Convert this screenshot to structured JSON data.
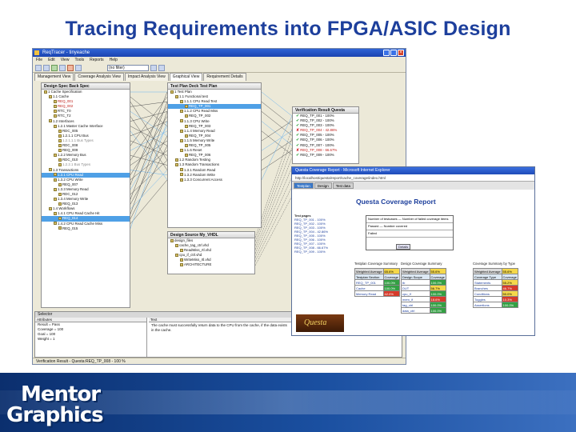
{
  "slide": {
    "title": "Tracing Requirements into FPGA/ASIC Design"
  },
  "app": {
    "window_title": "ReqTracer - tinyeache",
    "menu": [
      "File",
      "Edit",
      "View",
      "Tools",
      "Reports",
      "Help"
    ],
    "toolbar_select": "(no filter)",
    "tabs": [
      "Management View",
      "Coverage Analysis View",
      "Impact Analysis View",
      "Graphical View",
      "Requirement Details"
    ],
    "active_tab_index": 3,
    "panes": {
      "design_spec": {
        "header": "Design Spec   Back Spec",
        "rows": [
          {
            "text": "1 Cache Specification",
            "indent": 0
          },
          {
            "text": "1.1 Cache",
            "indent": 1
          },
          {
            "text": "REQ_001",
            "indent": 2,
            "style": "red"
          },
          {
            "text": "REQ_002",
            "indent": 2,
            "style": "red"
          },
          {
            "text": "RTC_T0",
            "indent": 2
          },
          {
            "text": "RTC_T2",
            "indent": 2
          },
          {
            "text": "1.2 Interfaces",
            "indent": 1
          },
          {
            "text": "1.2.1 Master Cache Interface",
            "indent": 2
          },
          {
            "text": "RDC_005",
            "indent": 3
          },
          {
            "text": "1.2.1.1 CPU Bus",
            "indent": 3
          },
          {
            "text": "1.2.1.1.1 Bus Types",
            "indent": 3,
            "style": "gray"
          },
          {
            "text": "RDC_008",
            "indent": 3
          },
          {
            "text": "REQ_009",
            "indent": 3
          },
          {
            "text": "1.2.2 Memory Bus",
            "indent": 2
          },
          {
            "text": "RDC_010",
            "indent": 3
          },
          {
            "text": "1.2.2.1 Bus Types",
            "indent": 3,
            "style": "gray"
          },
          {
            "text": "1.3 Transactions",
            "indent": 1
          },
          {
            "text": "1.3.1 CPU Read",
            "indent": 2,
            "style": "sel"
          },
          {
            "text": "1.3.2 CPU Write",
            "indent": 2
          },
          {
            "text": "REQ_007",
            "indent": 3
          },
          {
            "text": "1.3.3 Memory Read",
            "indent": 2
          },
          {
            "text": "RDC_012",
            "indent": 3
          },
          {
            "text": "1.3.4 Memory Write",
            "indent": 2
          },
          {
            "text": "REQ_013",
            "indent": 3
          },
          {
            "text": "1.4 Workflows",
            "indent": 1
          },
          {
            "text": "1.4.1 CPU Read Cache Hit",
            "indent": 2
          },
          {
            "text": "REQ_014",
            "indent": 3,
            "style": "sel"
          },
          {
            "text": "1.4.2 CPU Read Cache Miss",
            "indent": 2
          },
          {
            "text": "REQ_015",
            "indent": 3
          }
        ]
      },
      "test_plan": {
        "header": "Test Plan   Deck Test Plan",
        "rows": [
          {
            "text": "1 Test Plan",
            "indent": 0
          },
          {
            "text": "1.1 Functional test",
            "indent": 1
          },
          {
            "text": "1.1.1 CPU Read Test",
            "indent": 2
          },
          {
            "text": "REQ_TP_001",
            "indent": 3,
            "style": "sel"
          },
          {
            "text": "1.1.2 CPU Read Miss",
            "indent": 2
          },
          {
            "text": "REQ_TP_002",
            "indent": 3
          },
          {
            "text": "1.1.3 CPU Write",
            "indent": 2
          },
          {
            "text": "REQ_TP_003",
            "indent": 3
          },
          {
            "text": "1.1.4 Memory Read",
            "indent": 2
          },
          {
            "text": "REQ_TP_004",
            "indent": 3
          },
          {
            "text": "1.1.5 Memory Write",
            "indent": 2
          },
          {
            "text": "REQ_TP_005",
            "indent": 3
          },
          {
            "text": "1.1.6 Reset",
            "indent": 2
          },
          {
            "text": "REQ_TP_006",
            "indent": 3
          },
          {
            "text": "1.2 Random Testing",
            "indent": 1
          },
          {
            "text": "1.3 Random Transactions",
            "indent": 1
          },
          {
            "text": "1.3.1 Random Read",
            "indent": 2
          },
          {
            "text": "1.3.2 Random Write",
            "indent": 2
          },
          {
            "text": "1.3.3 Concurrent Access",
            "indent": 2
          }
        ]
      },
      "verification": {
        "header": "Verification Result   Questa",
        "rows": [
          {
            "text": "REQ_TP_001 - 100%",
            "status": "pass"
          },
          {
            "text": "REQ_TP_002 - 100%",
            "status": "pass"
          },
          {
            "text": "REQ_TP_003 - 100%",
            "status": "pass"
          },
          {
            "text": "REQ_TP_004 - 42.86%",
            "status": "fail"
          },
          {
            "text": "REQ_TP_005 - 100%",
            "status": "pass"
          },
          {
            "text": "REQ_TP_006 - 100%",
            "status": "pass"
          },
          {
            "text": "REQ_TP_007 - 100%",
            "status": "pass"
          },
          {
            "text": "REQ_TP_008 - 66.67%",
            "status": "fail"
          },
          {
            "text": "REQ_TP_009 - 100%",
            "status": "pass"
          }
        ]
      },
      "design_source": {
        "header": "Design Source   My_VHDL",
        "rows": [
          {
            "text": "design_files",
            "indent": 0
          },
          {
            "text": "cache_tag_ctrl.vhd",
            "indent": 1
          },
          {
            "text": "ReadMiss_rtl.vhd",
            "indent": 2
          },
          {
            "text": "cpu_if_ctrl.vhd",
            "indent": 1
          },
          {
            "text": "WriteMiss_rtl.vhd",
            "indent": 2
          },
          {
            "text": "ARCHITECTURE",
            "indent": 2
          }
        ]
      }
    },
    "bottom": {
      "selector_label": "Selector",
      "attributes_header": "Attributes",
      "text_header": "Text",
      "value_header": "Value",
      "attributes": [
        "Result = Pass",
        "Coverage = 100",
        "Goal = 100",
        "Weight = 1"
      ],
      "text": "The cache must successfully return data to the CPU from the cache, if the data exists in the cache."
    },
    "status": "Verification Result - Questa:REQ_TP_008 - 100 %"
  },
  "browser": {
    "title": "Questa Coverage Report - Microsoft Internet Explorer",
    "address": "http://localhost/questa/report/cache_coverage/index.html",
    "tabs": [
      "Testplan",
      "Design",
      "Test data"
    ],
    "report_title": "Questa Coverage Report",
    "side_heading": "Test pages",
    "side_rows": [
      "REQ_TP_001 - 100%",
      "REQ_TP_002 - 100%",
      "REQ_TP_003 - 100%",
      "REQ_TP_004 - 42.86%",
      "REQ_TP_005 - 100%",
      "REQ_TP_006 - 100%",
      "REQ_TP_007 - 100%",
      "REQ_TP_008 - 66.67%",
      "REQ_TP_009 - 100%"
    ],
    "summary": [
      {
        "label": "Number of testcases",
        "value": "Number of failed coverage items"
      },
      {
        "label": "Passed",
        "value": "Number covered"
      },
      {
        "label": "Failed",
        "value": ""
      }
    ],
    "summary_link": "Details",
    "sections": {
      "testplan": "Testplan Coverage Summary",
      "design": "Design Coverage Summary",
      "type": "Coverage Summary by Type"
    },
    "testplan_table": [
      [
        "Weighted Average",
        "65.6%"
      ],
      [
        "Testplan Section",
        "Coverage"
      ],
      [
        "REQ_TP_001",
        "100.0%"
      ],
      [
        "Cache",
        "100.0%"
      ],
      [
        "Memory Read",
        "42.0%"
      ]
    ],
    "design_table": [
      [
        "Weighted Average",
        "55.6%"
      ],
      [
        "Design Scope",
        "Coverage"
      ],
      [
        "tb",
        "100.0%"
      ],
      [
        "DUT",
        "56.7%"
      ],
      [
        "cpu_if",
        "100.0%"
      ],
      [
        "mem_if",
        "18.6%"
      ],
      [
        "tag_ctrl",
        "100.0%"
      ],
      [
        "data_ctrl",
        "100.0%"
      ]
    ],
    "type_table": [
      [
        "Weighted Average",
        "55.6%"
      ],
      [
        "Coverage Type",
        "Coverage"
      ],
      [
        "Statements",
        "55.2%"
      ],
      [
        "Branches",
        "46.7%"
      ],
      [
        "Conditions",
        "50.0%"
      ],
      [
        "Toggles",
        "10.3%"
      ],
      [
        "Assertions",
        "100.0%"
      ]
    ],
    "logo_text": "Questa"
  },
  "footer": {
    "logo_line1": "Mentor",
    "logo_line2": "Graphics"
  }
}
